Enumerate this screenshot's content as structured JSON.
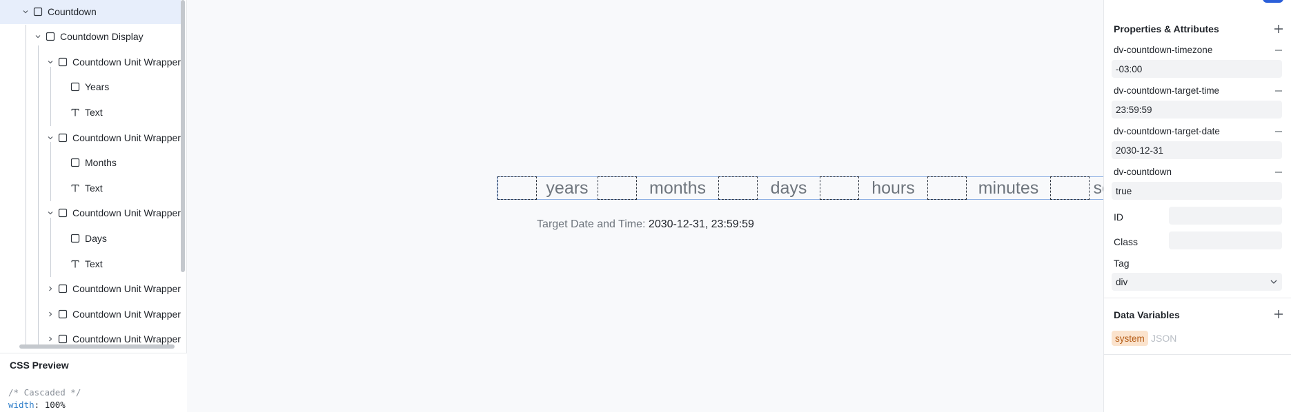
{
  "navigator": {
    "tree": [
      {
        "label": "Countdown",
        "icon": "square-icon",
        "expander": "expanded",
        "selected": true
      },
      {
        "label": "Countdown Display",
        "icon": "square-icon",
        "expander": "expanded",
        "selected": false
      },
      {
        "label": "Countdown Unit Wrapper",
        "icon": "square-icon",
        "expander": "expanded",
        "selected": false
      },
      {
        "label": "Years",
        "icon": "square-icon",
        "expander": "none",
        "selected": false
      },
      {
        "label": "Text",
        "icon": "text-icon",
        "expander": "none",
        "selected": false
      },
      {
        "label": "Countdown Unit Wrapper",
        "icon": "square-icon",
        "expander": "expanded",
        "selected": false
      },
      {
        "label": "Months",
        "icon": "square-icon",
        "expander": "none",
        "selected": false
      },
      {
        "label": "Text",
        "icon": "text-icon",
        "expander": "none",
        "selected": false
      },
      {
        "label": "Countdown Unit Wrapper",
        "icon": "square-icon",
        "expander": "expanded",
        "selected": false
      },
      {
        "label": "Days",
        "icon": "square-icon",
        "expander": "none",
        "selected": false
      },
      {
        "label": "Text",
        "icon": "text-icon",
        "expander": "none",
        "selected": false
      },
      {
        "label": "Countdown Unit Wrapper",
        "icon": "square-icon",
        "expander": "collapsed",
        "selected": false
      },
      {
        "label": "Countdown Unit Wrapper",
        "icon": "square-icon",
        "expander": "collapsed",
        "selected": false
      },
      {
        "label": "Countdown Unit Wrapper",
        "icon": "square-icon",
        "expander": "collapsed",
        "selected": false
      }
    ]
  },
  "css_preview": {
    "title": "CSS Preview",
    "comment": "/* Cascaded */",
    "property": "width",
    "value": "100%"
  },
  "canvas": {
    "units": [
      "years",
      "months",
      "days",
      "hours",
      "minutes",
      "seconds"
    ],
    "target_label": "Target Date and Time:",
    "target_value": "2030-12-31, 23:59:59"
  },
  "properties": {
    "title": "Properties & Attributes",
    "attributes": [
      {
        "name": "dv-countdown-timezone",
        "value": "-03:00"
      },
      {
        "name": "dv-countdown-target-time",
        "value": "23:59:59"
      },
      {
        "name": "dv-countdown-target-date",
        "value": "2030-12-31"
      },
      {
        "name": "dv-countdown",
        "value": "true"
      }
    ],
    "id_label": "ID",
    "id_value": "",
    "class_label": "Class",
    "class_value": "",
    "tag_label": "Tag",
    "tag_value": "div"
  },
  "data_variables": {
    "title": "Data Variables",
    "chip_system": "system",
    "chip_json": "JSON"
  },
  "colors": {
    "accent": "#2b5fd9",
    "selected_row": "#e7eefb",
    "chip_bg": "#fbe3cd",
    "chip_text": "#b45b14"
  }
}
